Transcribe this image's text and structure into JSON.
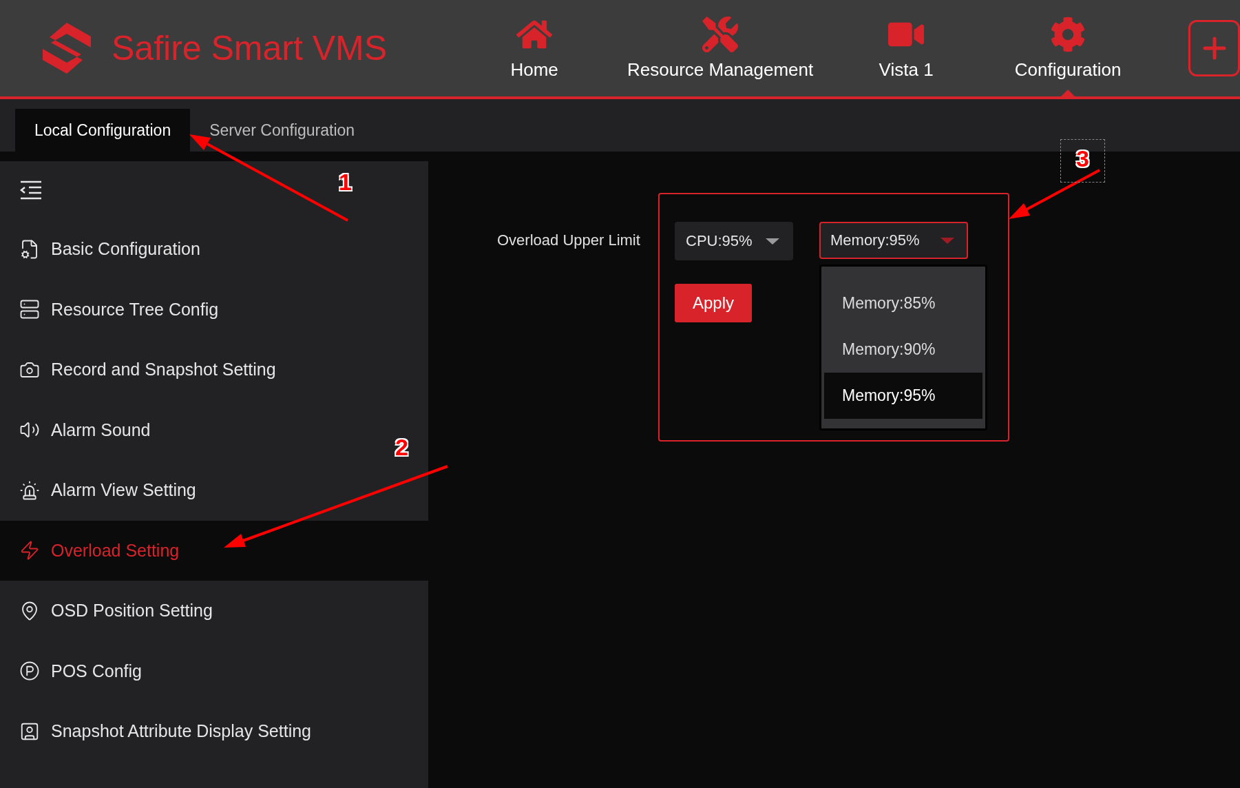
{
  "header": {
    "logo_text": "Safire Smart VMS",
    "nav": [
      {
        "label": "Home",
        "selected": false
      },
      {
        "label": "Resource Management",
        "selected": false
      },
      {
        "label": "Vista 1",
        "selected": false
      },
      {
        "label": "Configuration",
        "selected": true
      }
    ]
  },
  "subtabs": [
    {
      "label": "Local Configuration",
      "selected": true
    },
    {
      "label": "Server Configuration",
      "selected": false
    }
  ],
  "sidebar": {
    "items": [
      {
        "label": "Basic Configuration",
        "selected": false
      },
      {
        "label": "Resource Tree Config",
        "selected": false
      },
      {
        "label": "Record and Snapshot Setting",
        "selected": false
      },
      {
        "label": "Alarm Sound",
        "selected": false
      },
      {
        "label": "Alarm View Setting",
        "selected": false
      },
      {
        "label": "Overload Setting",
        "selected": true
      },
      {
        "label": "OSD Position Setting",
        "selected": false
      },
      {
        "label": "POS Config",
        "selected": false
      },
      {
        "label": "Snapshot Attribute Display Setting",
        "selected": false
      }
    ]
  },
  "settings": {
    "label": "Overload Upper Limit",
    "cpu_select": {
      "value": "CPU:95%"
    },
    "memory_select": {
      "value": "Memory:95%",
      "expanded": true,
      "options": [
        {
          "label": "Memory:85%",
          "selected": false
        },
        {
          "label": "Memory:90%",
          "selected": false
        },
        {
          "label": "Memory:95%",
          "selected": true
        }
      ]
    },
    "apply_button": "Apply"
  },
  "annotations": [
    {
      "label": "1"
    },
    {
      "label": "2"
    },
    {
      "label": "3"
    }
  ]
}
